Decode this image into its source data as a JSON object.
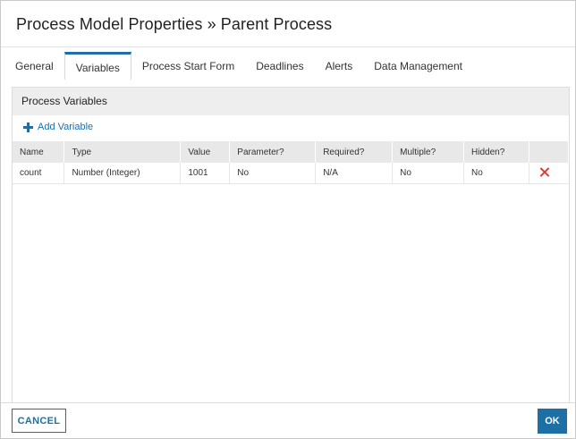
{
  "dialog": {
    "title": "Process Model Properties » Parent Process"
  },
  "tabs": [
    {
      "label": "General",
      "active": false
    },
    {
      "label": "Variables",
      "active": true
    },
    {
      "label": "Process Start Form",
      "active": false
    },
    {
      "label": "Deadlines",
      "active": false
    },
    {
      "label": "Alerts",
      "active": false
    },
    {
      "label": "Data Management",
      "active": false
    }
  ],
  "panel": {
    "header": "Process Variables",
    "add_variable_label": "Add Variable"
  },
  "table": {
    "columns": [
      "Name",
      "Type",
      "Value",
      "Parameter?",
      "Required?",
      "Multiple?",
      "Hidden?",
      ""
    ],
    "rows": [
      {
        "name": "count",
        "type": "Number (Integer)",
        "value": "1001",
        "parameter": "No",
        "required": "N/A",
        "multiple": "No",
        "hidden": "No",
        "action_icon": "delete-icon"
      }
    ]
  },
  "footer": {
    "cancel_label": "CANCEL",
    "ok_label": "OK"
  },
  "colors": {
    "accent": "#1d6fa5",
    "delete": "#d93a3a",
    "header_bg": "#eeeeee"
  }
}
